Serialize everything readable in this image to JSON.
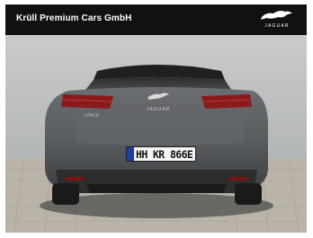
{
  "header": {
    "dealer_name": "Krüll Premium Cars GmbH",
    "brand_logo_text": "JAGUAR"
  },
  "vehicle": {
    "license_plate": "HH KR 866E",
    "model_badge": "I-PACE",
    "rear_brand_badge": "JAGUAR"
  },
  "colors": {
    "header_bg": "#111111",
    "car_body": "#5b5e61",
    "taillight": "#8a1a1c",
    "plate_eu_band": "#1d3e9a"
  },
  "icons": [
    "leaper-icon",
    "eu-band-icon"
  ]
}
